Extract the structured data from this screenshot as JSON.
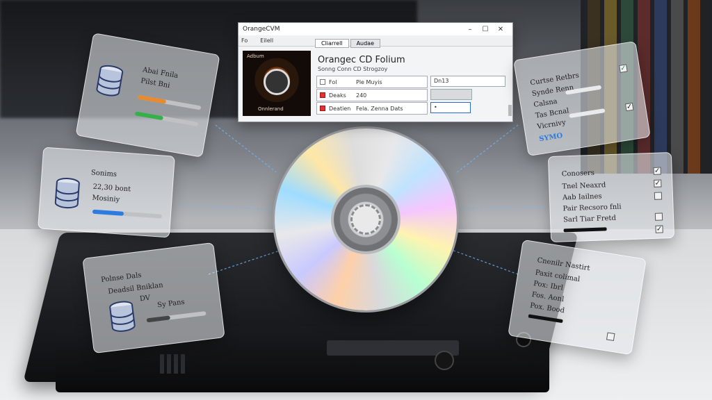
{
  "window": {
    "title": "OrangeCVM",
    "controls": {
      "minimize": "–",
      "maximize": "☐",
      "close": "✕"
    },
    "menu": [
      "Fo",
      "Eilell"
    ],
    "tabs": [
      "Cliarrell",
      "Audae"
    ],
    "cover": {
      "top_label": "Adbum",
      "bottom_label": "Onnlerand"
    },
    "heading": "Orangec CD Folium",
    "subheading": "Sonng Conn CD Strogzoy",
    "rows": [
      {
        "c1": "Fol",
        "c2": "Ple Muyis",
        "checked": false,
        "field": "Dn13"
      },
      {
        "c1": "Deaks",
        "c2": "240",
        "checked": true,
        "field": ""
      },
      {
        "c1": "Deatien",
        "c2": "Fela. Zenna Dats",
        "checked": true,
        "field": "•"
      }
    ]
  },
  "cards": {
    "top_left": {
      "line1": "Abai Fnila",
      "line2": "Pilst Bni",
      "fills": [
        0.45,
        0.45
      ],
      "colors": [
        "#e88a2e",
        "#35b04a"
      ]
    },
    "mid_left": {
      "line1": "Sonims",
      "line2": "22,30 bont",
      "line3": "Mosiniy",
      "fills": [
        0.45
      ],
      "colors": [
        "#2b7be0"
      ]
    },
    "bottom_left": {
      "line1": "Polnse Dals",
      "line2": "Deadsil Bniklan",
      "line3": "DV",
      "line4": "Sy Pans"
    },
    "top_right": {
      "line1": "Curtse Retbrs",
      "line2": "Synde Renn",
      "line3": "Calsna",
      "line4": "Tas Bcnal",
      "line5": "Vicrnivy",
      "line6": "SYMO"
    },
    "mid_right": {
      "line1": "Conosers",
      "line2": "Tnel Neaxrd",
      "line3": "Aab Iailnes",
      "line4": "Pair Recsoro fnli",
      "line5": "Sarl Tiar Fretd",
      "checks": [
        true,
        true,
        false,
        false,
        true
      ]
    },
    "bottom_right": {
      "line1": "Cnenilr Nastirt",
      "line2": "Paxit colimal",
      "line3": "Pox: Ibrl",
      "line4": "Fos. Aonl",
      "line5": "Pox. Bood"
    }
  },
  "colors": {
    "accent_orange": "#e88a2e",
    "accent_green": "#35b04a",
    "accent_blue": "#2b7be0"
  }
}
